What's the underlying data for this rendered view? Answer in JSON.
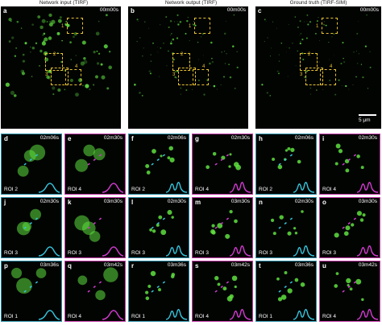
{
  "headers": {
    "col1": "Network input (TIRF)",
    "col2": "Network output (TIRF)",
    "col3": "Ground truth (TIRF-SIM)"
  },
  "big_panels": [
    {
      "label": "a",
      "time": "00m00s"
    },
    {
      "label": "b",
      "time": "00m00s"
    },
    {
      "label": "c",
      "time": "00m00s"
    }
  ],
  "box_numbers": [
    "1",
    "2",
    "3",
    "4"
  ],
  "scale_bar": "5 μm",
  "small_panels": [
    {
      "label": "d",
      "time": "02m06s",
      "roi": "ROI 2"
    },
    {
      "label": "e",
      "time": "02m30s",
      "roi": "ROI 4"
    },
    {
      "label": "f",
      "time": "02m06s",
      "roi": "ROI 2"
    },
    {
      "label": "g",
      "time": "02m30s",
      "roi": "ROI 4"
    },
    {
      "label": "h",
      "time": "02m06s",
      "roi": "ROI 2"
    },
    {
      "label": "i",
      "time": "02m30s",
      "roi": "ROI 4"
    },
    {
      "label": "j",
      "time": "02m30s",
      "roi": "ROI 3"
    },
    {
      "label": "k",
      "time": "03m30s",
      "roi": "ROI 3"
    },
    {
      "label": "l",
      "time": "02m30s",
      "roi": "ROI 3"
    },
    {
      "label": "m",
      "time": "03m30s",
      "roi": "ROI 3"
    },
    {
      "label": "n",
      "time": "02m30s",
      "roi": "ROI 3"
    },
    {
      "label": "o",
      "time": "03m30s",
      "roi": "ROI 3"
    },
    {
      "label": "p",
      "time": "03m36s",
      "roi": "ROI 1"
    },
    {
      "label": "q",
      "time": "03m42s",
      "roi": "ROI 4"
    },
    {
      "label": "r",
      "time": "03m36s",
      "roi": "ROI 1"
    },
    {
      "label": "s",
      "time": "03m42s",
      "roi": "ROI 4"
    },
    {
      "label": "t",
      "time": "03m36s",
      "roi": "ROI 1"
    },
    {
      "label": "u",
      "time": "03m42s",
      "roi": "ROI 4"
    }
  ],
  "colors": {
    "cyan": "#35c4dc",
    "magenta": "#d23ad0",
    "box": "#e8c230",
    "signal": "#5fe040"
  }
}
